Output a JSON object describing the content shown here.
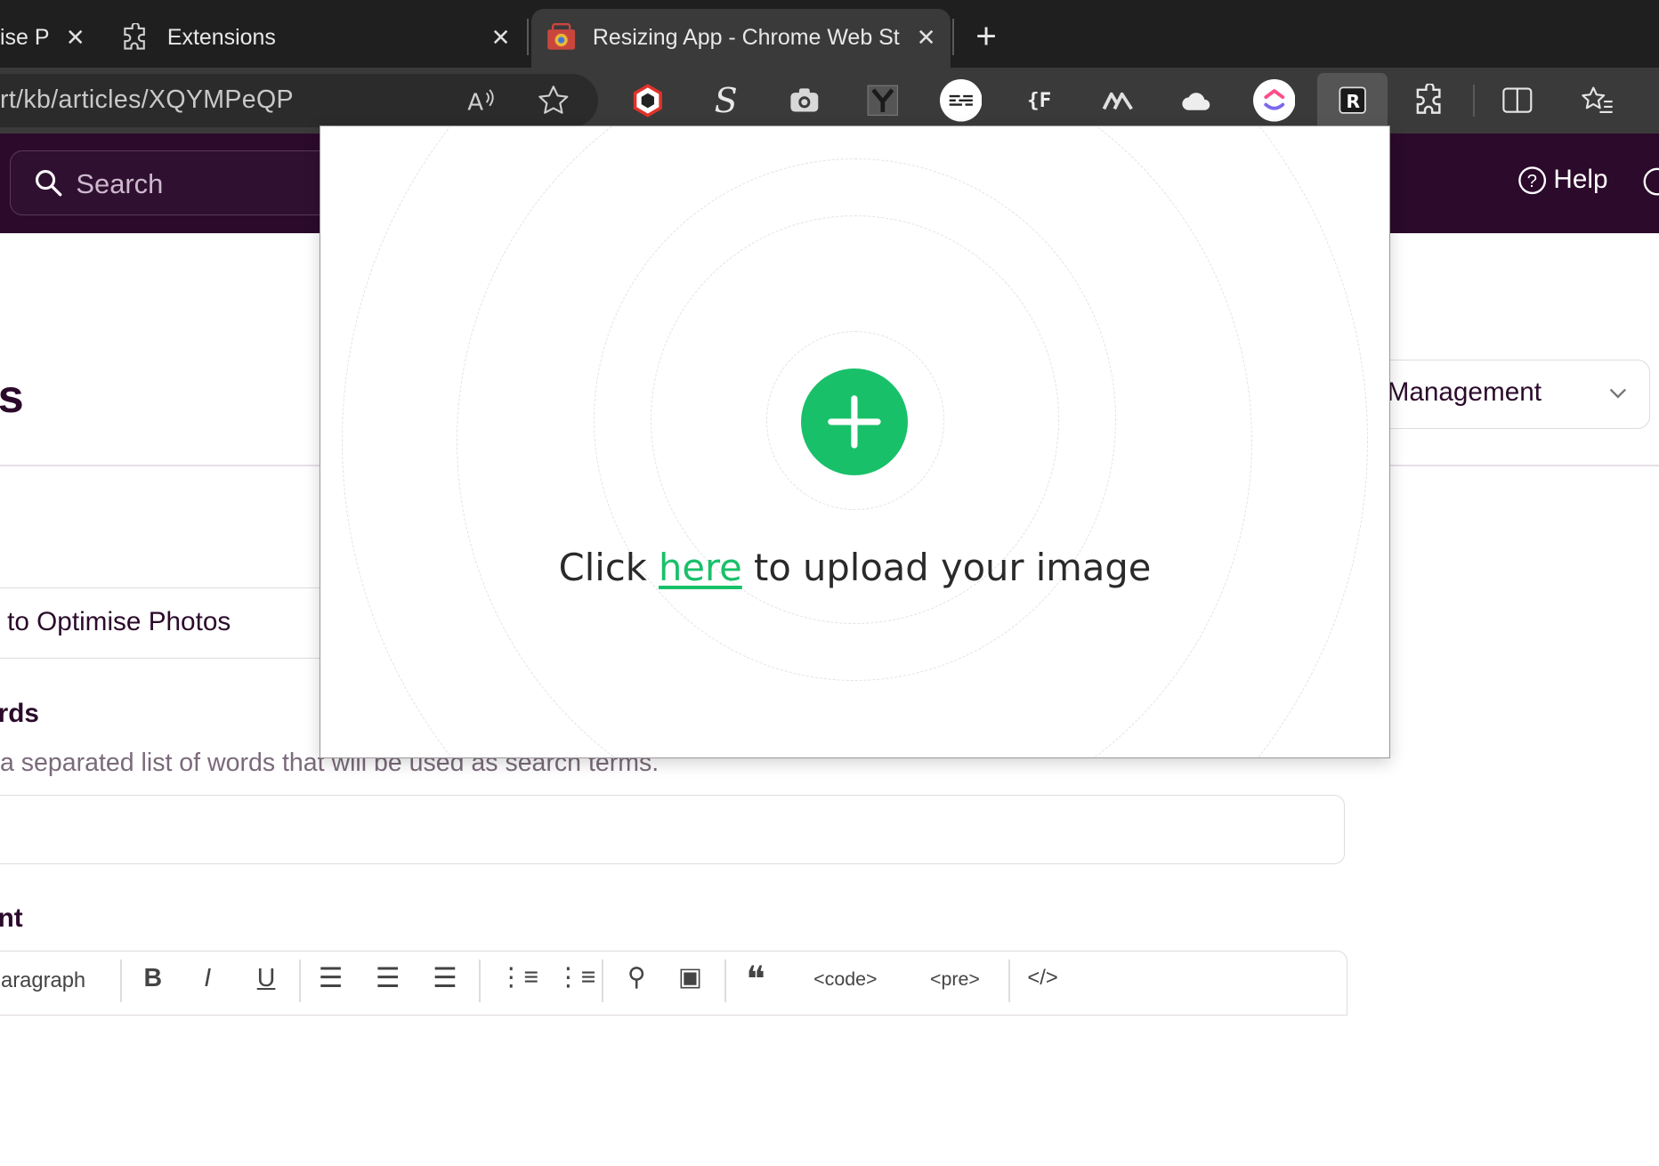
{
  "browser": {
    "tabs": [
      {
        "label": "ise P",
        "close": "✕"
      },
      {
        "label": "Extensions",
        "close": "✕"
      },
      {
        "label": "Resizing App - Chrome Web St",
        "close": "✕"
      }
    ],
    "new_tab": "+",
    "url": "rt/kb/articles/XQYMPeQP",
    "extensions": [
      {
        "icon": "cube-extension-icon",
        "glyph": "⬢"
      },
      {
        "icon": "s-extension-icon",
        "glyph": "S"
      },
      {
        "icon": "camera-extension-icon",
        "glyph": "📷"
      },
      {
        "icon": "y-extension-icon",
        "glyph": "Y"
      },
      {
        "icon": "menu-lines-extension-icon",
        "glyph": "≡"
      },
      {
        "icon": "font-extension-icon",
        "glyph": "{F"
      },
      {
        "icon": "mountain-extension-icon",
        "glyph": "⋀⋀"
      },
      {
        "icon": "cloud-extension-icon",
        "glyph": "☁"
      },
      {
        "icon": "clickup-extension-icon",
        "glyph": ""
      },
      {
        "icon": "resizing-app-extension-icon",
        "glyph": "R"
      }
    ]
  },
  "site": {
    "search_placeholder": "Search",
    "help_label": "Help",
    "heading_fragment": "s",
    "category_value": "Management",
    "title_value": "to Optimise Photos",
    "keywords_label": "rds",
    "keywords_hint": "a separated list of words that will be used as search terms.",
    "content_label": "nt",
    "editor_paragraph_label": "aragraph"
  },
  "popup": {
    "upload_prefix": "Click ",
    "upload_link": "here",
    "upload_suffix": " to upload your image",
    "accent_color": "#19c06a"
  }
}
